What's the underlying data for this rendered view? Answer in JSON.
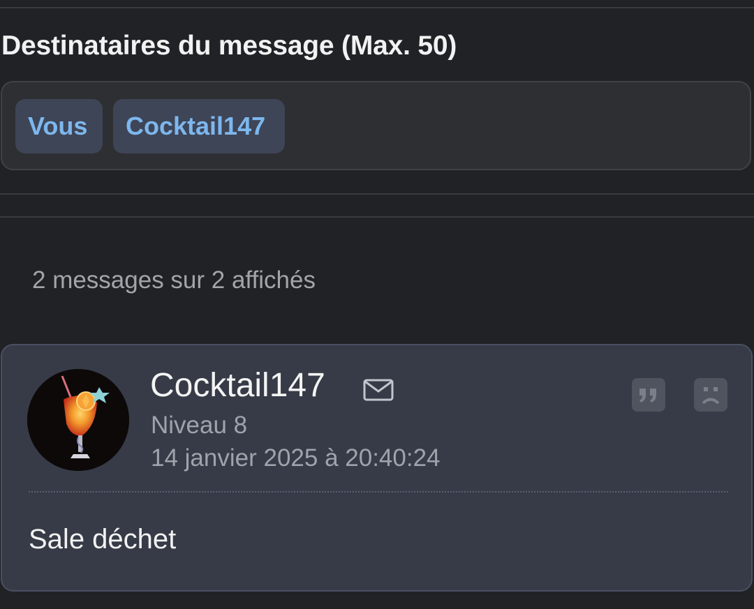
{
  "recipients": {
    "title": "Destinataires du message (Max. 50)",
    "chips": [
      "Vous",
      "Cocktail147"
    ]
  },
  "thread": {
    "count_text": "2 messages sur 2 affichés"
  },
  "message": {
    "author": "Cocktail147",
    "level": "Niveau 8",
    "date": "14 janvier 2025 à 20:40:24",
    "body": "Sale déchet",
    "icons": {
      "avatar": "cocktail-glass-avatar",
      "mail": "envelope-icon",
      "quote": "quote-icon",
      "report": "sad-face-icon"
    }
  },
  "colors": {
    "background": "#212226",
    "chip_background": "#3e4556",
    "chip_text": "#7db7ee",
    "card_background": "#363b47",
    "muted_text": "#9fa3ac"
  }
}
